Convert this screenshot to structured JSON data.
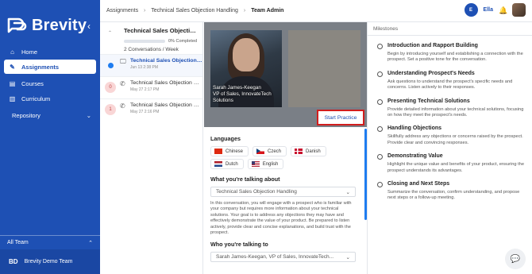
{
  "brand": {
    "name": "Brevity",
    "color": "#1e50b4"
  },
  "sidebar": {
    "items": [
      {
        "label": "Home",
        "icon": "home-icon"
      },
      {
        "label": "Assignments",
        "icon": "assignment-icon"
      },
      {
        "label": "Courses",
        "icon": "courses-icon"
      },
      {
        "label": "Curriculum",
        "icon": "curriculum-icon"
      }
    ],
    "repository": "Repository",
    "team_section": "All Team",
    "team_initials": "BD",
    "team_name": "Brevity Demo Team"
  },
  "breadcrumb": {
    "items": [
      "Assignments",
      "Technical Sales Objection Handling",
      "Team Admin"
    ]
  },
  "user": {
    "initials": "E",
    "name": "Ella"
  },
  "assignment": {
    "title": "Technical Sales Objection Handling",
    "progress_label": "0% Completed",
    "progress": 0,
    "cadence": "2 Conversations / Week"
  },
  "conversations": [
    {
      "title": "Technical Sales Objection Handling",
      "date": "Jun 13 2:38 PM",
      "badge": ""
    },
    {
      "title": "Technical Sales Objection Handling",
      "date": "May 27 2:17 PM",
      "badge": "0"
    },
    {
      "title": "Technical Sales Objection Handling",
      "date": "May 27 2:16 PM",
      "badge": "1"
    }
  ],
  "persona": {
    "name": "Sarah James-Keegan",
    "title": "VP of Sales, InnovateTech",
    "company": "Solutions"
  },
  "start_button": "Start Practice",
  "languages": {
    "label": "Languages",
    "items": [
      "Chinese",
      "Czech",
      "Danish",
      "Dutch",
      "English"
    ]
  },
  "topic": {
    "label": "What you're talking about",
    "value": "Technical Sales Objection Handling",
    "description": "In this conversation, you will engage with a prospect who is familiar with your company but requires more information about your technical solutions. Your goal is to address any objections they may have and effectively demonstrate the value of your product. Be prepared to listen actively, provide clear and concise explanations, and build trust with the prospect."
  },
  "talking_to": {
    "label": "Who you're talking to",
    "value": "Sarah James-Keegan, VP of Sales, InnovateTech..."
  },
  "milestones": {
    "header": "Milestones",
    "items": [
      {
        "title": "Introduction and Rapport Building",
        "desc": "Begin by introducing yourself and establishing a connection with the prospect. Set a positive tone for the conversation."
      },
      {
        "title": "Understanding Prospect's Needs",
        "desc": "Ask questions to understand the prospect's specific needs and concerns. Listen actively to their responses."
      },
      {
        "title": "Presenting Technical Solutions",
        "desc": "Provide detailed information about your technical solutions, focusing on how they meet the prospect's needs."
      },
      {
        "title": "Handling Objections",
        "desc": "Skillfully address any objections or concerns raised by the prospect. Provide clear and convincing responses."
      },
      {
        "title": "Demonstrating Value",
        "desc": "Highlight the unique value and benefits of your product, ensuring the prospect understands its advantages."
      },
      {
        "title": "Closing and Next Steps",
        "desc": "Summarize the conversation, confirm understanding, and propose next steps or a follow-up meeting."
      }
    ]
  }
}
